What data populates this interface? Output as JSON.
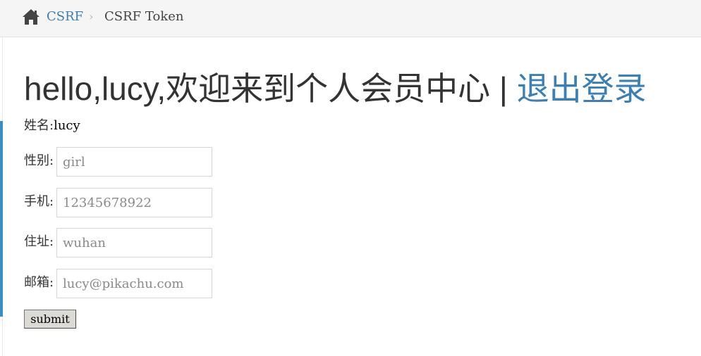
{
  "breadcrumb": {
    "home_icon": "home-icon",
    "link_label": "CSRF",
    "separator": "›",
    "current_label": "CSRF Token"
  },
  "title": {
    "greeting": "hello,lucy,欢迎来到个人会员中心 | ",
    "logout_label": "退出登录"
  },
  "profile": {
    "name_label": "姓名:",
    "name_value": "lucy",
    "fields": [
      {
        "label": "性别:",
        "placeholder": "girl"
      },
      {
        "label": "手机:",
        "placeholder": "12345678922"
      },
      {
        "label": "住址:",
        "placeholder": "wuhan"
      },
      {
        "label": "邮箱:",
        "placeholder": "lucy@pikachu.com"
      }
    ]
  },
  "form": {
    "submit_label": "submit"
  },
  "colors": {
    "link": "#3a7fb5",
    "accent": "#3a8cc4",
    "breadcrumb_bg": "#f5f5f5"
  }
}
